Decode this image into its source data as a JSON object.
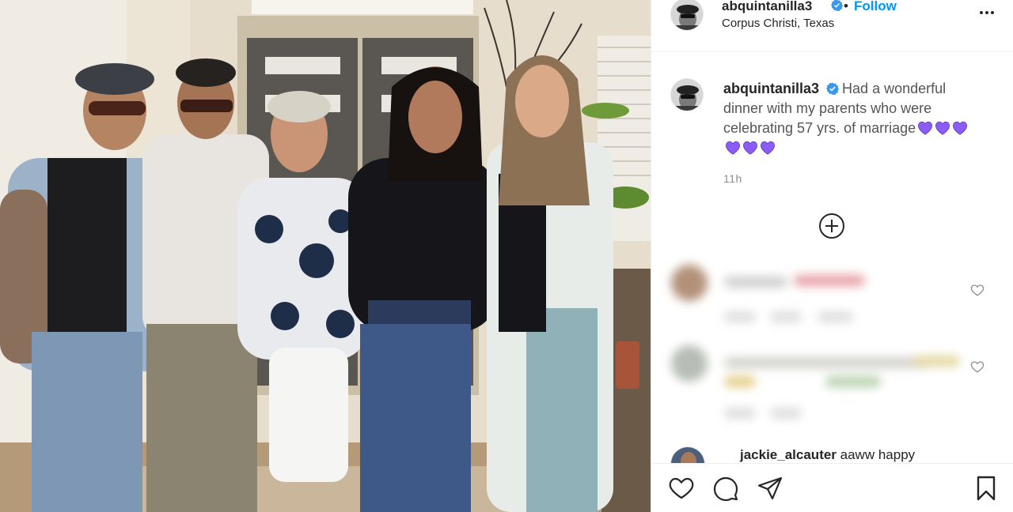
{
  "post": {
    "username": "abquintanilla3",
    "follow_label": "Follow",
    "separator": "•",
    "location": "Corpus Christi, Texas",
    "caption": "Had a wonderful dinner with my parents who were celebrating 57 yrs. of marriage",
    "caption_hearts": 6,
    "timestamp": "11h"
  },
  "comments": {
    "partial_username": "jackie_alcauter",
    "partial_text": " aaww happy"
  },
  "icons": {
    "verified": "verified-badge-icon",
    "more": "more-options-icon",
    "load_more": "plus-circle-icon",
    "like": "heart-outline-icon",
    "comment": "comment-bubble-icon",
    "share": "paper-plane-icon",
    "save": "bookmark-icon"
  },
  "colors": {
    "link_blue": "#0095f6",
    "verified_blue": "#3897f0",
    "purple_heart": "#8b5cf6",
    "muted": "#8e8e8e"
  }
}
